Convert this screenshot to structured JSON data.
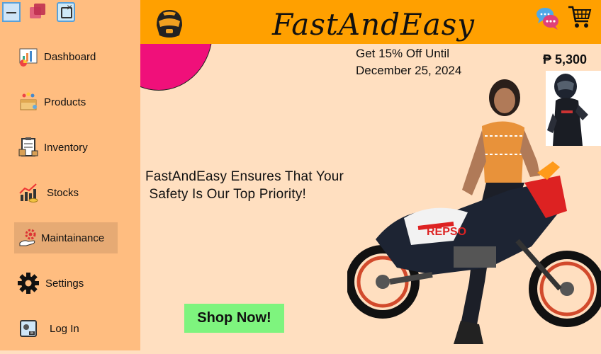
{
  "window": {
    "icons": [
      "minimize-icon",
      "maximize-icon",
      "close-icon"
    ]
  },
  "header": {
    "brand": "FastAndEasy",
    "logo_icon": "helmet-icon",
    "chat_icon": "chat-icon",
    "cart_icon": "cart-icon"
  },
  "sidebar": {
    "items": [
      {
        "label": "Dashboard",
        "icon": "dashboard-icon",
        "active": false
      },
      {
        "label": "Products",
        "icon": "products-icon",
        "active": false
      },
      {
        "label": "Inventory",
        "icon": "inventory-icon",
        "active": false
      },
      {
        "label": "Stocks",
        "icon": "stocks-icon",
        "active": false
      },
      {
        "label": "Maintainance",
        "icon": "maintenance-icon",
        "active": true
      },
      {
        "label": "Settings",
        "icon": "gear-icon",
        "active": false
      },
      {
        "label": "Log In",
        "icon": "login-icon",
        "active": false
      }
    ]
  },
  "main": {
    "promo_line1": "Get 15% Off Until",
    "promo_line2": "December 25, 2024",
    "price": "₱ 5,300",
    "tagline_line1": "FastAndEasy Ensures That Your",
    "tagline_line2": " Safety Is Our Top Priority!",
    "shop_button": "Shop Now!"
  },
  "colors": {
    "sidebar_bg": "#ffbd80",
    "header_bg": "#ffa000",
    "content_bg": "#ffdfc0",
    "accent_magenta": "#f0107a",
    "shop_button_bg": "#7ef47e",
    "active_item_bg": "#e6aa74"
  }
}
